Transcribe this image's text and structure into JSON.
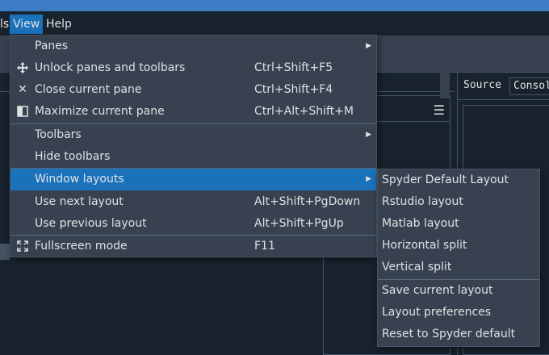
{
  "menubar": {
    "items": [
      {
        "label": "ls"
      },
      {
        "label": "View"
      },
      {
        "label": "Help"
      }
    ]
  },
  "right_pane": {
    "tabs": [
      "Source",
      "Consol"
    ]
  },
  "left_pane": {
    "options_icon": "hamburger-menu-icon"
  },
  "view_menu": {
    "items": [
      {
        "label": "Panes",
        "shortcut": "",
        "icon": "",
        "submenu": true
      },
      {
        "label": "Unlock panes and toolbars",
        "shortcut": "Ctrl+Shift+F5",
        "icon": "move-arrows-icon"
      },
      {
        "label": "Close current pane",
        "shortcut": "Ctrl+Shift+F4",
        "icon": "close-x-icon"
      },
      {
        "label": "Maximize current pane",
        "shortcut": "Ctrl+Alt+Shift+M",
        "icon": "maximize-pane-icon"
      },
      {
        "label": "Toolbars",
        "shortcut": "",
        "icon": "",
        "submenu": true
      },
      {
        "label": "Hide toolbars",
        "shortcut": "",
        "icon": ""
      },
      {
        "label": "Window layouts",
        "shortcut": "",
        "icon": "",
        "submenu": true,
        "highlighted": true
      },
      {
        "label": "Use next layout",
        "shortcut": "Alt+Shift+PgDown",
        "icon": ""
      },
      {
        "label": "Use previous layout",
        "shortcut": "Alt+Shift+PgUp",
        "icon": ""
      },
      {
        "label": "Fullscreen mode",
        "shortcut": "F11",
        "icon": "fullscreen-icon"
      }
    ]
  },
  "layouts_submenu": {
    "items": [
      {
        "label": "Spyder Default Layout"
      },
      {
        "label": "Rstudio layout"
      },
      {
        "label": "Matlab layout"
      },
      {
        "label": "Horizontal split"
      },
      {
        "label": "Vertical split"
      },
      {
        "label": "Save current layout"
      },
      {
        "label": "Layout preferences"
      },
      {
        "label": "Reset to Spyder default"
      }
    ]
  },
  "colors": {
    "background": "#19232d",
    "menu_background": "#37414f",
    "highlight": "#1a72bb",
    "title_bar": "#3c7cc4",
    "text": "#e0e1e3"
  }
}
